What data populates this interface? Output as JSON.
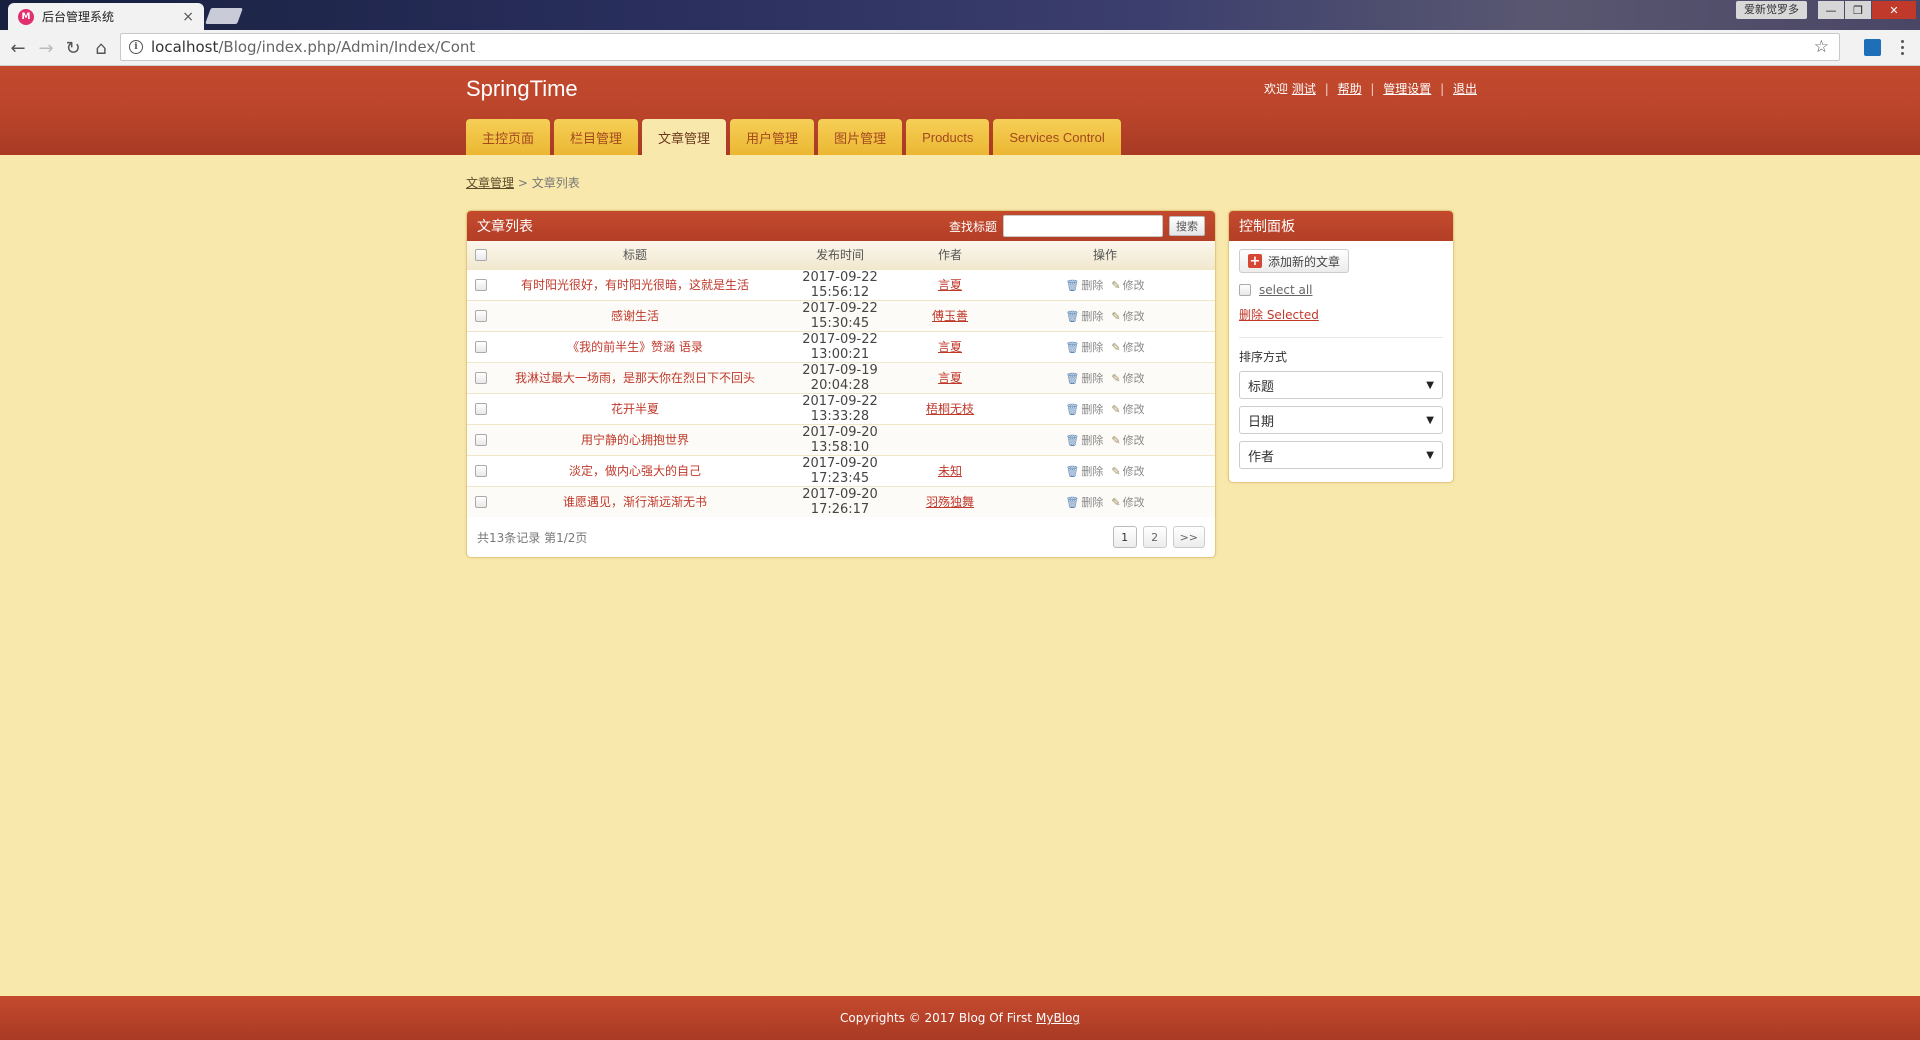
{
  "browser": {
    "tab_title": "后台管理系统",
    "tab_close": "×",
    "url_host": "localhost",
    "url_path": "/Blog/index.php/Admin/Index/Cont",
    "window_user": "爱新觉罗多"
  },
  "site": {
    "brand": "SpringTime",
    "welcome": "欢迎",
    "username": "测试",
    "links": [
      "帮助",
      "管理设置",
      "退出"
    ],
    "link_sep": "|"
  },
  "nav": {
    "tabs": [
      {
        "label": "主控页面",
        "active": false
      },
      {
        "label": "栏目管理",
        "active": false
      },
      {
        "label": "文章管理",
        "active": true
      },
      {
        "label": "用户管理",
        "active": false
      },
      {
        "label": "图片管理",
        "active": false
      },
      {
        "label": "Products",
        "active": false
      },
      {
        "label": "Services Control",
        "active": false
      }
    ]
  },
  "breadcrumb": {
    "parent": "文章管理",
    "sep": ">",
    "current": "文章列表"
  },
  "list": {
    "title": "文章列表",
    "search_label": "查找标题",
    "search_placeholder": "",
    "search_button": "搜索",
    "columns": [
      "标题",
      "发布时间",
      "作者",
      "操作"
    ],
    "delete_label": "删除",
    "edit_label": "修改",
    "rows": [
      {
        "title": "有时阳光很好，有时阳光很暗，这就是生活",
        "date": "2017-09-22 15:56:12",
        "author": "言夏"
      },
      {
        "title": "感谢生活",
        "date": "2017-09-22 15:30:45",
        "author": "傅玉善"
      },
      {
        "title": "《我的前半生》赞涵 语录",
        "date": "2017-09-22 13:00:21",
        "author": "言夏"
      },
      {
        "title": "我淋过最大一场雨，是那天你在烈日下不回头",
        "date": "2017-09-19 20:04:28",
        "author": "言夏"
      },
      {
        "title": "花开半夏",
        "date": "2017-09-22 13:33:28",
        "author": "梧桐无枝"
      },
      {
        "title": "用宁静的心拥抱世界",
        "date": "2017-09-20 13:58:10",
        "author": ""
      },
      {
        "title": "淡定，做内心强大的自己",
        "date": "2017-09-20 17:23:45",
        "author": "未知"
      },
      {
        "title": "谁愿遇见，渐行渐远渐无书",
        "date": "2017-09-20 17:26:17",
        "author": "羽殇独舞"
      }
    ],
    "total_text": "共13条记录 第1/2页",
    "pages": [
      "1",
      "2",
      ">>"
    ]
  },
  "control": {
    "title": "控制面板",
    "add_button": "添加新的文章",
    "select_all": "select all",
    "delete_selected": "删除 Selected",
    "sort_label": "排序方式",
    "sort_options": [
      "标题",
      "日期",
      "作者"
    ]
  },
  "footer": {
    "text": "Copyrights © 2017 Blog Of First",
    "link": "MyBlog"
  }
}
